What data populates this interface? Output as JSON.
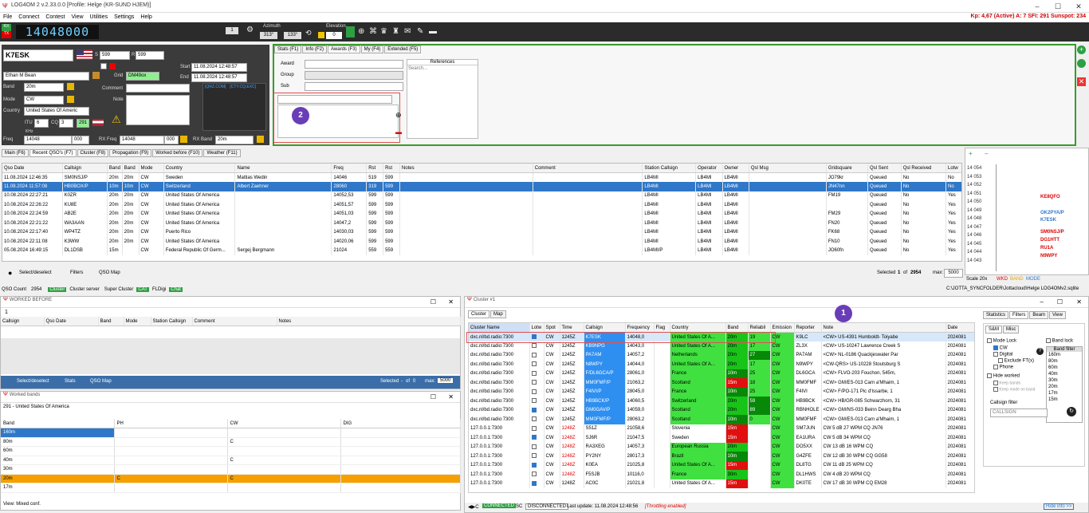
{
  "app": {
    "title": "LOG4OM 2 v.2.33.0.0 [Profile: Helge (KR-SUND HJEM)]"
  },
  "menu": [
    "File",
    "Connect",
    "Contest",
    "View",
    "Utilities",
    "Settings",
    "Help"
  ],
  "solar": "Kp: 4,67 (Active)  A: 7  SFI: 291 Sunspot: 234",
  "toolbar": {
    "rx": "RX",
    "tx": "TX",
    "frequency": "14048000",
    "ch": "1",
    "azimuth_label": "Azimuth",
    "az1": "313°",
    "az2": "133°",
    "elevation_label": "Elevation",
    "elevation": "0"
  },
  "call": {
    "callsign": "K7ESK",
    "s": "S",
    "s_val": "599",
    "r": "R",
    "r_val": "599",
    "name": "Ethan M Bean",
    "grid_label": "Grid",
    "grid": "DM49ox",
    "band_label": "Band",
    "band": "20m",
    "mode_label": "Mode",
    "mode": "CW",
    "country_label": "Country",
    "country": "United States Of Americ",
    "itu_label": "ITU",
    "itu": "6",
    "cq_label": "CQ",
    "cq": "3",
    "extra": "291",
    "freq_label": "Freq",
    "freq_unit": "KHz",
    "freq": "14048",
    "freq_hz": "000",
    "rxfreq_label": "RX Freq",
    "rxfreq": "14048",
    "rxfreq_hz": "000",
    "rxband_label": "RX Band",
    "rxband": "20m",
    "start_label": "Start",
    "start": "11.08.2024 12:48:57",
    "end_label": "End",
    "end": "11.08.2024 12:48:57",
    "comment_label": "Comment",
    "note_label": "Note",
    "qrz": "[QRZ.COM]",
    "ctyexc": "[CTY.CQ.EXC]"
  },
  "awards": {
    "tabs": [
      "Stats (F1)",
      "Info (F2)",
      "Awards (F3)",
      "My (F4)",
      "Extended (F5)"
    ],
    "award": "Award",
    "group": "Group",
    "sub": "Sub",
    "references": "References",
    "search_placeholder": "Search..."
  },
  "bottomtabs": [
    "Main (F6)",
    "Recent QSO's (F7)",
    "Cluster (F8)",
    "Propagation (F9)",
    "Worked before (F10)",
    "Weather (F11)"
  ],
  "qso": {
    "headers": [
      "Qso Date",
      "Callsign",
      "Band",
      "Band",
      "Mode",
      "Country",
      "Name",
      "Freq",
      "Rst",
      "Rst",
      "Notes",
      "Comment",
      "Station Callsign",
      "Operator",
      "Owner",
      "Qsl Msg",
      "Gridsquare",
      "Qsl Sent",
      "Qsl Received",
      "Lotw"
    ],
    "rows": [
      [
        "11.08.2024 12:46:35",
        "SM0NSJ/P",
        "20m",
        "20m",
        "CW",
        "Sweden",
        "Mattias Wedin",
        "14046",
        "519",
        "599",
        "",
        "",
        "LB4MI",
        "LB4MI",
        "LB4MI",
        "",
        "JO79kr",
        "Queued",
        "No",
        "No"
      ],
      [
        "11.08.2024 11:57:08",
        "HB0BOX/P",
        "10m",
        "10m",
        "CW",
        "Switzerland",
        "Albert Zaehner",
        "28060",
        "319",
        "599",
        "",
        "",
        "LB4MI",
        "LB4MI",
        "LB4MI",
        "",
        "JN47nn",
        "Queued",
        "No",
        "No"
      ],
      [
        "10.08.2024 22:27:21",
        "K0ZR",
        "20m",
        "20m",
        "CW",
        "United States Of America",
        "",
        "14052,53",
        "599",
        "599",
        "",
        "",
        "LB4MI",
        "LB4MI",
        "LB4MI",
        "",
        "FM19",
        "Queued",
        "No",
        "Yes"
      ],
      [
        "10.08.2024 22:26:22",
        "KU8E",
        "20m",
        "20m",
        "CW",
        "United States Of America",
        "",
        "14051,57",
        "599",
        "599",
        "",
        "",
        "LB4MI",
        "LB4MI",
        "LB4MI",
        "",
        "",
        "Queued",
        "No",
        "Yes"
      ],
      [
        "10.08.2024 22:24:59",
        "AB2E",
        "20m",
        "20m",
        "CW",
        "United States Of America",
        "",
        "14051,03",
        "599",
        "599",
        "",
        "",
        "LB4MI",
        "LB4MI",
        "LB4MI",
        "",
        "FM29",
        "Queued",
        "No",
        "Yes"
      ],
      [
        "10.08.2024 22:21:22",
        "WA3AAN",
        "20m",
        "20m",
        "CW",
        "United States Of America",
        "",
        "14047,2",
        "599",
        "599",
        "",
        "",
        "LB4MI",
        "LB4MI",
        "LB4MI",
        "",
        "FN20",
        "Queued",
        "No",
        "Yes"
      ],
      [
        "10.08.2024 22:17:40",
        "WP4TZ",
        "20m",
        "20m",
        "CW",
        "Puerto Rico",
        "",
        "14030,03",
        "599",
        "599",
        "",
        "",
        "LB4MI",
        "LB4MI",
        "LB4MI",
        "",
        "FK68",
        "Queued",
        "No",
        "Yes"
      ],
      [
        "10.08.2024 22:11:08",
        "K3WW",
        "20m",
        "20m",
        "CW",
        "United States Of America",
        "",
        "14020,06",
        "599",
        "599",
        "",
        "",
        "LB4MI",
        "LB4MI",
        "LB4MI",
        "",
        "FN10",
        "Queued",
        "No",
        "Yes"
      ],
      [
        "05.08.2024 16:49:15",
        "DL1DSB",
        "15m",
        "",
        "CW",
        "Federal Republic Of Germ...",
        "Sergej Bergmann",
        "21024",
        "559",
        "559",
        "",
        "",
        "LB4MI/P",
        "LB4MI",
        "LB4MI",
        "",
        "JO60fn",
        "Queued",
        "No",
        "Yes"
      ]
    ],
    "select_label": "Select/deselect",
    "filters_label": "Filters",
    "qsomap_label": "QSO Map",
    "selected": "Selected",
    "sel_num": "1",
    "of": "of",
    "total": "2954",
    "max": "max:",
    "max_val": "5000"
  },
  "bandmap": {
    "freqs": [
      "14 054",
      "14 053",
      "14 052",
      "14 051",
      "14 050",
      "14 049",
      "14 048",
      "14 047",
      "14 046",
      "14 045",
      "14 044",
      "14 043"
    ],
    "spots": [
      "KE8QFO",
      "OK2PYA/P",
      "K7ESK",
      "SM0NSJ/P",
      "DG1HTT",
      "RU1A",
      "N9WPY"
    ],
    "scale": "Scale 20x",
    "wkd": "WKD",
    "band": "BAND",
    "mode": "MODE"
  },
  "status": {
    "qsocount_label": "QSO Count",
    "qsocount": "2954",
    "items": [
      "Cluster",
      "Cluster server",
      "Super Cluster",
      "CAT",
      "FLDigi",
      "Chat"
    ],
    "path": "C:\\JOTTA_SYNCFOLDER\\Jottacloud\\Helge LOG4OMv2.sqlite"
  },
  "worked": {
    "title": "WORKED BEFORE",
    "count": "1",
    "headers": [
      "Callsign",
      "Qso Date",
      "Band",
      "Mode",
      "Station Callsign",
      "Comment",
      "Notes"
    ],
    "select": "Select/deselect",
    "stats": "Stats",
    "map": "QSO Map",
    "selected": "Selected",
    "sel": "-",
    "of": "of",
    "total": "0",
    "max": "max:",
    "max_val": "5000"
  },
  "workedbands": {
    "title": "Worked bands",
    "country": "291 - United States Of America",
    "headers": [
      "Band",
      "PH",
      "CW",
      "DIG"
    ],
    "rows": [
      [
        "160m",
        "",
        "",
        ""
      ],
      [
        "80m",
        "",
        "C",
        ""
      ],
      [
        "60m",
        "",
        "",
        ""
      ],
      [
        "40m",
        "",
        "C",
        ""
      ],
      [
        "30m",
        "",
        "",
        ""
      ],
      [
        "20m",
        "C",
        "C",
        ""
      ],
      [
        "17m",
        "",
        "",
        ""
      ]
    ],
    "view": "View:  Mixed conf."
  },
  "cluster": {
    "title": "Cluster #1",
    "tabs": [
      "Cluster",
      "Map"
    ],
    "headers": [
      "Cluster Name",
      "Lotw",
      "Spot",
      "Time",
      "Callsign",
      "Frequency",
      "Flag",
      "Country",
      "Band",
      "Reliabil",
      "Emission",
      "Reporter",
      "Note",
      "Date"
    ],
    "rows": [
      [
        "dxc.nl/bd.radio:7300",
        "",
        "CW",
        "1245Z",
        "K7ESK",
        "14048,0",
        "",
        "United States Of A...",
        "20m",
        "19",
        "CW",
        "K9LC",
        "<CW> US-4391 Humboldt- Toiyabe",
        "2024081"
      ],
      [
        "dxc.nl/bd.radio:7300",
        "",
        "CW",
        "1245Z",
        "KB9NPG",
        "14043,0",
        "",
        "United States Of A...",
        "20m",
        "17",
        "CW",
        "ZL3X",
        "<CW> US-10247 Lawrence Creek S",
        "2024081"
      ],
      [
        "dxc.nl/bd.radio:7300",
        "",
        "CW",
        "1245Z",
        "PA7AM",
        "14057,2",
        "",
        "Netherlands",
        "20m",
        "27",
        "CW",
        "PA7AM",
        "<CW> NL-0186 Quackjeswater Par",
        "2024081"
      ],
      [
        "dxc.nl/bd.radio:7300",
        "",
        "CW",
        "1245Z",
        "N8WPY",
        "14044,0",
        "",
        "United States Of A...",
        "20m",
        "17",
        "CW",
        "N9WPY",
        "<CW-QRS> US-10228 Stoutsburg S",
        "2024081"
      ],
      [
        "dxc.nl/bd.radio:7300",
        "",
        "CW",
        "1245Z",
        "F/DL6GCA/P",
        "28061,0",
        "",
        "France",
        "10m",
        "25",
        "CW",
        "DL6GCA",
        "<CW> FLVO-203 Fouchon, 545m,",
        "2024081"
      ],
      [
        "dxc.nl/bd.radio:7300",
        "",
        "CW",
        "1245Z",
        "MM0FMF/P",
        "21063,2",
        "",
        "Scotland",
        "15m",
        "18",
        "CW",
        "MM0FMF",
        "<CW> GM/ES-013 Carn a'Mhaim, 1",
        "2024081"
      ],
      [
        "dxc.nl/bd.radio:7300",
        "",
        "CW",
        "1245Z",
        "F4IVI/P",
        "28045,0",
        "",
        "France",
        "10m",
        "25",
        "CW",
        "F4IVI",
        "<CW> F/PO-171 Pic d'Issarbe, 1",
        "2024081"
      ],
      [
        "dxc.nl/bd.radio:7300",
        "",
        "CW",
        "1245Z",
        "HB9BCK/P",
        "14060,5",
        "",
        "Switzerland",
        "20m",
        "59",
        "CW",
        "HB9BCK",
        "<CW> HB/GR-085 Schwarzhorn, 31",
        "2024081"
      ],
      [
        "dxc.nl/bd.radio:7300",
        "",
        "CW",
        "1245Z",
        "GM0GAV/P",
        "14059,0",
        "",
        "Scotland",
        "20m",
        "89",
        "CW",
        "RBNHOLE",
        "<CW> GM/NS-033 Beinn Dearg Bha",
        "2024081"
      ],
      [
        "dxc.nl/bd.radio:7300",
        "",
        "CW",
        "1245Z",
        "MM0FMF/P",
        "28063,2",
        "",
        "Scotland",
        "10m",
        "0",
        "CW",
        "MM0FMF",
        "<CW> GM/ES-013 Carn a'Mhaim, 1",
        "2024081"
      ],
      [
        "127.0.0.1:7300",
        "",
        "CW",
        "1248Z",
        "S51Z",
        "21058,6",
        "",
        "Slovenia",
        "15m",
        "",
        "CW",
        "SM7JUN",
        "CW  5 dB 27 WPM CQ       JN76",
        "2024081"
      ],
      [
        "127.0.0.1:7300",
        "",
        "CW",
        "1248Z",
        "SJ6R",
        "21047,5",
        "",
        "Sweden",
        "15m",
        "",
        "CW",
        "EA1URA",
        "CW  5 dB 34 WPM CQ",
        "2024081"
      ],
      [
        "127.0.0.1:7300",
        "",
        "CW",
        "1248Z",
        "RA3XEG",
        "14057,3",
        "",
        "European Russia",
        "20m",
        "",
        "CW",
        "DO5XX",
        "CW 13 dB 16 WPM CQ",
        "2024081"
      ],
      [
        "127.0.0.1:7300",
        "",
        "CW",
        "1248Z",
        "PY2NY",
        "28017,3",
        "",
        "Brazil",
        "10m",
        "",
        "CW",
        "G4ZFE",
        "CW 12 dB 30 WPM CQ       GG58",
        "2024081"
      ],
      [
        "127.0.0.1:7300",
        "",
        "CW",
        "1248Z",
        "K0EA",
        "21025,8",
        "",
        "United States Of A...",
        "15m",
        "",
        "CW",
        "DL8TG",
        "CW 11 dB 25 WPM CQ",
        "2024081"
      ],
      [
        "127.0.0.1:7300",
        "",
        "CW",
        "1248Z",
        "F5SJB",
        "10116,0",
        "",
        "France",
        "30m",
        "",
        "CW",
        "DL1HWS",
        "CW  4 dB 20 WPM CQ",
        "2024081"
      ],
      [
        "127.0.0.1:7300",
        "",
        "CW",
        "1248Z",
        "AC0C",
        "21021,8",
        "",
        "United States Of A...",
        "15m",
        "",
        "CW",
        "DK0TE",
        "CW 17 dB 30 WPM CQ       EM28",
        "2024081"
      ]
    ],
    "connected": "CONNECTED",
    "sc": "SC",
    "disconnected": "DISCONNECTED",
    "last_update": "Last update: 11.08.2024 12:48:56",
    "throttling": "[Throttling enabled]",
    "hide_info": "Hide info >>"
  },
  "cluster_side": {
    "tabs": [
      "Statistics",
      "Filters",
      "Beam",
      "View"
    ],
    "subtabs": [
      "S&M",
      "Misc"
    ],
    "mode_lock": "Mode Lock",
    "band_lock": "Band lock",
    "cw": "CW",
    "digital": "Digital",
    "exclude_ft": "Exclude FT(x)",
    "phone": "Phone",
    "band_filter": "Band filter",
    "bands": [
      "160m",
      "80m",
      "60m",
      "40m",
      "30m",
      "20m",
      "17m",
      "15m"
    ],
    "hide_worked": "Hide worked",
    "keep_bands": "Keep bands",
    "keep_mode": "Keep mode on band",
    "callsign_filter": "Callsign filter",
    "callsign_placeholder": "CALLSIGN"
  },
  "annotations": {
    "one": "1",
    "two": "2"
  },
  "colors": {
    "accent": "#2f77c8",
    "toolbar": "#2b2b2b",
    "annot": "#6a3db8"
  }
}
